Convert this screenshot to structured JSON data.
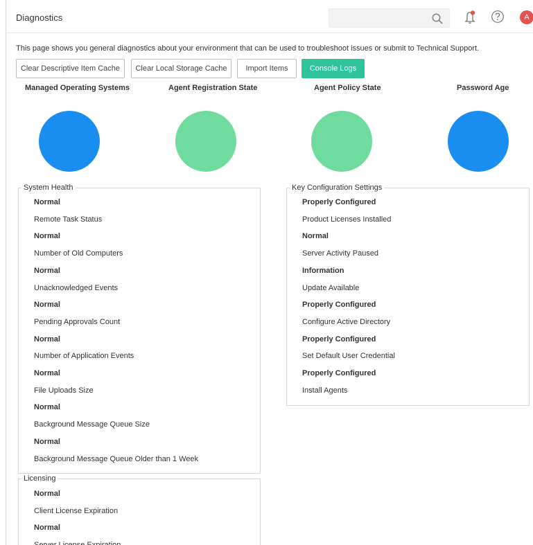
{
  "header": {
    "title": "Diagnostics",
    "search_placeholder": "",
    "avatar_initial": "A"
  },
  "description": "This page shows you general diagnostics about your environment that can be used to troubleshoot issues or submit to Technical Support.",
  "buttons": {
    "clear_descriptive": "Clear Descriptive Item Cache",
    "clear_local": "Clear Local Storage Cache",
    "import_items": "Import Items",
    "console_logs": "Console Logs"
  },
  "charts": {
    "managed_os": "Managed Operating Systems",
    "agent_registration": "Agent Registration State",
    "agent_policy": "Agent Policy State",
    "password_age": "Password Age"
  },
  "chart_colors": {
    "blue": "#1a8ef0",
    "green": "#6fdc9e",
    "accent": "#2fc49a"
  },
  "system_health": {
    "title": "System Health",
    "rows": [
      "Normal",
      "Remote Task Status",
      "Normal",
      "Number of Old Computers",
      "Normal",
      "Unacknowledged Events",
      "Normal",
      "Pending Approvals Count",
      "Normal",
      "Number of Application Events",
      "Normal",
      "File Uploads Size",
      "Normal",
      "Background Message Queue Size",
      "Normal",
      "Background Message Queue Older than 1 Week"
    ]
  },
  "key_config": {
    "title": "Key Configuration Settings",
    "rows": [
      "Properly Configured",
      "Product Licenses Installed",
      "Normal",
      "Server Activity Paused",
      "Information",
      "Update Available",
      "Properly Configured",
      "Configure Active Directory",
      "Properly Configured",
      "Set Default User Credential",
      "Properly Configured",
      "Install Agents"
    ]
  },
  "licensing": {
    "title": "Licensing",
    "rows": [
      "Normal",
      "Client License Expiration",
      "Normal",
      "Server License Expiration"
    ]
  }
}
